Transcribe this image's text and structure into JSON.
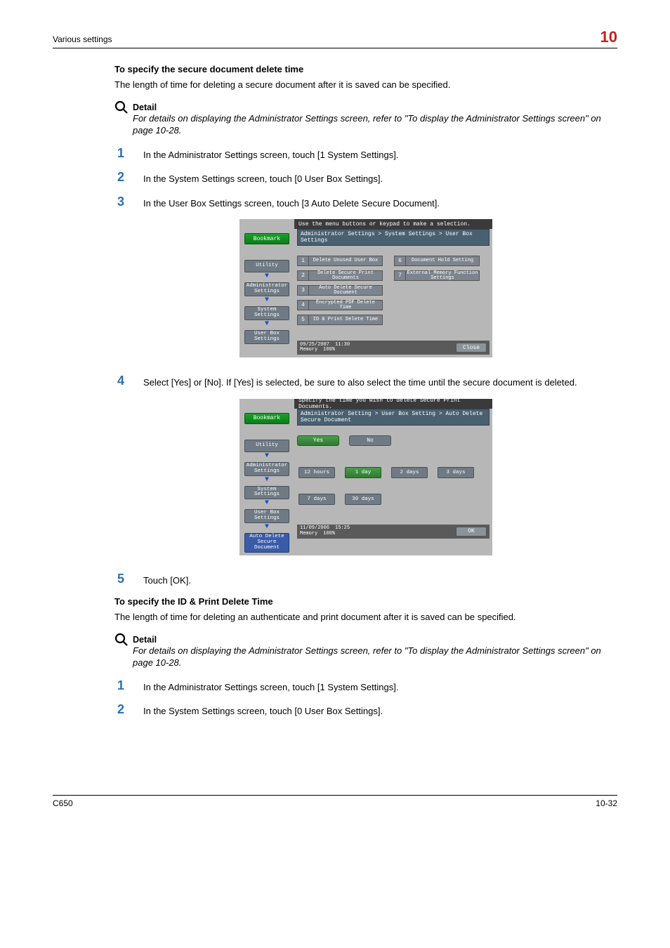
{
  "header": {
    "left": "Various settings",
    "right": "10"
  },
  "section1": {
    "title": "To specify the secure document delete time",
    "intro": "The length of time for deleting a secure document after it is saved can be specified.",
    "detail_label": "Detail",
    "detail_text": "For details on displaying the Administrator Settings screen, refer to \"To display the Administrator Settings screen\" on page 10-28.",
    "steps": [
      {
        "n": "1",
        "t": "In the Administrator Settings screen, touch [1 System Settings]."
      },
      {
        "n": "2",
        "t": "In the System Settings screen, touch [0 User Box Settings]."
      },
      {
        "n": "3",
        "t": "In the User Box Settings screen, touch [3 Auto Delete Secure Document]."
      }
    ],
    "step4": {
      "n": "4",
      "t": "Select [Yes] or [No]. If [Yes] is selected, be sure to also select the time until the secure document is deleted."
    },
    "step5": {
      "n": "5",
      "t": "Touch [OK]."
    }
  },
  "screen1": {
    "top_instr": "Use the menu buttons or keypad to make a selection.",
    "bookmark": "Bookmark",
    "side": [
      "Utility",
      "Administrator Settings",
      "System Settings",
      "User Box Settings"
    ],
    "breadcrumb": "Administrator Settings > System Settings > User Box Settings",
    "options_left": [
      {
        "n": "1",
        "label": "Delete Unused User Box"
      },
      {
        "n": "2",
        "label": "Delete Secure Print Documents"
      },
      {
        "n": "3",
        "label": "Auto Delete Secure Document"
      },
      {
        "n": "4",
        "label": "Encrypted PDF Delete Time"
      },
      {
        "n": "5",
        "label": "ID & Print Delete Time"
      }
    ],
    "options_right": [
      {
        "n": "6",
        "label": "Document Hold Setting"
      },
      {
        "n": "7",
        "label": "External Memory Function Settings"
      }
    ],
    "status": {
      "date": "09/25/2007",
      "time": "11:30",
      "mem_label": "Memory",
      "mem": "100%"
    },
    "close": "Close"
  },
  "screen2": {
    "top_instr": "Specify the time you wish to delete Secure Print Documents.",
    "bookmark": "Bookmark",
    "side": [
      "Utility",
      "Administrator Settings",
      "System Settings",
      "User Box Settings",
      "Auto Delete Secure Document"
    ],
    "breadcrumb": "Administrator Setting > User Box Setting > Auto Delete Secure Document",
    "tabs": {
      "yes": "Yes",
      "no": "No"
    },
    "choices": [
      "12 hours",
      "1 day",
      "2 days",
      "3 days",
      "7 days",
      "30 days"
    ],
    "status": {
      "date": "11/09/2006",
      "time": "15:25",
      "mem_label": "Memory",
      "mem": "100%"
    },
    "ok": "OK"
  },
  "section2": {
    "title": "To specify the ID & Print Delete Time",
    "intro": "The length of time for deleting an authenticate and print document after it is saved can be specified.",
    "detail_label": "Detail",
    "detail_text": "For details on displaying the Administrator Settings screen, refer to \"To display the Administrator Settings screen\" on page 10-28.",
    "steps": [
      {
        "n": "1",
        "t": "In the Administrator Settings screen, touch [1 System Settings]."
      },
      {
        "n": "2",
        "t": "In the System Settings screen, touch [0 User Box Settings]."
      }
    ]
  },
  "footer": {
    "left": "C650",
    "right": "10-32"
  }
}
